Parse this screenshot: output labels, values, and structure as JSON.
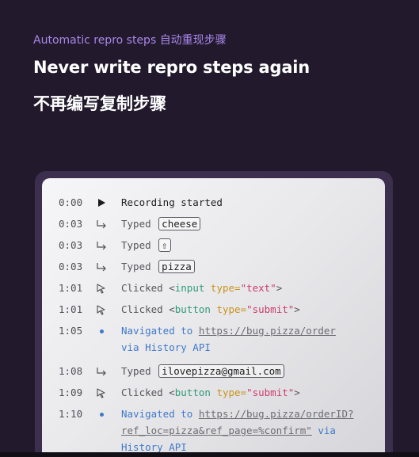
{
  "hero": {
    "eyebrow": "Automatic repro steps 自动重现步骤",
    "title": "Never write repro steps again",
    "title_cn": "不再编写复制步骤"
  },
  "log": {
    "r0": {
      "time": "0:00",
      "icon": "play-icon",
      "text": "Recording started"
    },
    "r1": {
      "time": "0:03",
      "icon": "enter-arrow-icon",
      "verb": "Typed",
      "key": "cheese"
    },
    "r2": {
      "time": "0:03",
      "icon": "enter-arrow-icon",
      "verb": "Typed",
      "key": "⇧"
    },
    "r3": {
      "time": "0:03",
      "icon": "enter-arrow-icon",
      "verb": "Typed",
      "key": "pizza"
    },
    "r4": {
      "time": "1:01",
      "icon": "cursor-icon",
      "verb": "Clicked",
      "lt": "<",
      "tag": "input",
      "attr": "type=",
      "val": "\"text\"",
      "gt": ">"
    },
    "r5": {
      "time": "1:01",
      "icon": "cursor-icon",
      "verb": "Clicked",
      "lt": "<",
      "tag": "button",
      "attr": "type=",
      "val": "\"submit\"",
      "gt": ">"
    },
    "r6": {
      "time": "1:05",
      "icon": "bullet-icon",
      "verb": "Navigated to",
      "url": "https://bug.pizza/order",
      "line2": "via History API"
    },
    "r7": {
      "time": "1:08",
      "icon": "enter-arrow-icon",
      "verb": "Typed",
      "key": "ilovepizza@gmail.com"
    },
    "r8": {
      "time": "1:09",
      "icon": "cursor-icon",
      "verb": "Clicked",
      "lt": "<",
      "tag": "button",
      "attr": "type=",
      "val": "\"submit\"",
      "gt": ">"
    },
    "r9": {
      "time": "1:10",
      "icon": "bullet-icon",
      "verb": "Navigated to",
      "url": "https://bug.pizza/orderID?",
      "url2": "ref_loc=pizza&ref_page=%confirm\"",
      "via": "via",
      "line3": "History API"
    }
  }
}
